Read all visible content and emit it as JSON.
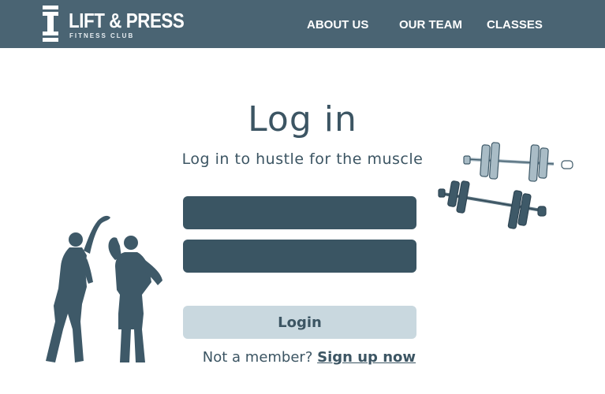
{
  "brand": {
    "name": "LIFT & PRESS",
    "tagline": "FITNESS CLUB",
    "logo_icon": "dumbbell-icon"
  },
  "nav": {
    "items": [
      {
        "label": "ABOUT US"
      },
      {
        "label": "OUR TEAM"
      },
      {
        "label": "CLASSES"
      }
    ]
  },
  "login": {
    "title": "Log in",
    "subtitle": "Log in to hustle for the muscle",
    "username": {
      "value": "",
      "placeholder": ""
    },
    "password": {
      "value": "",
      "placeholder": ""
    },
    "button_label": "Login",
    "member_prompt": "Not a member?",
    "signup_label": "Sign up now"
  },
  "illustrations": {
    "people": "stretching-people-icon",
    "equipment": "dumbbells-icon"
  },
  "colors": {
    "nav_background": "#4a6473",
    "text_primary": "#3c5563",
    "field_background": "#3a5563",
    "button_background": "#c9d8df",
    "background": "#ffffff"
  }
}
